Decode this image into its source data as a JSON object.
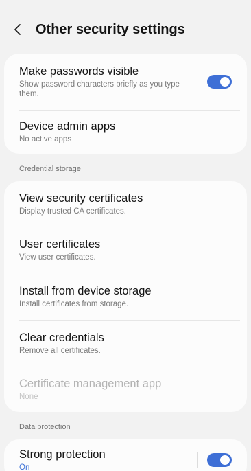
{
  "header": {
    "title": "Other security settings",
    "back_icon": "chevron-left-icon"
  },
  "group1": {
    "make_passwords_visible": {
      "title": "Make passwords visible",
      "subtitle": "Show password characters briefly as you type them.",
      "toggle_on": true
    },
    "device_admin_apps": {
      "title": "Device admin apps",
      "subtitle": "No active apps"
    }
  },
  "credential_storage": {
    "section_label": "Credential storage",
    "items": [
      {
        "title": "View security certificates",
        "subtitle": "Display trusted CA certificates."
      },
      {
        "title": "User certificates",
        "subtitle": "View user certificates."
      },
      {
        "title": "Install from device storage",
        "subtitle": "Install certificates from storage."
      },
      {
        "title": "Clear credentials",
        "subtitle": "Remove all certificates."
      },
      {
        "title": "Certificate management app",
        "subtitle": "None",
        "disabled": true
      }
    ]
  },
  "data_protection": {
    "section_label": "Data protection",
    "strong_protection": {
      "title": "Strong protection",
      "status": "On",
      "toggle_on": true
    }
  },
  "colors": {
    "accent": "#3e6fd6",
    "background": "#f2f2f2",
    "card": "#fcfcfc"
  }
}
